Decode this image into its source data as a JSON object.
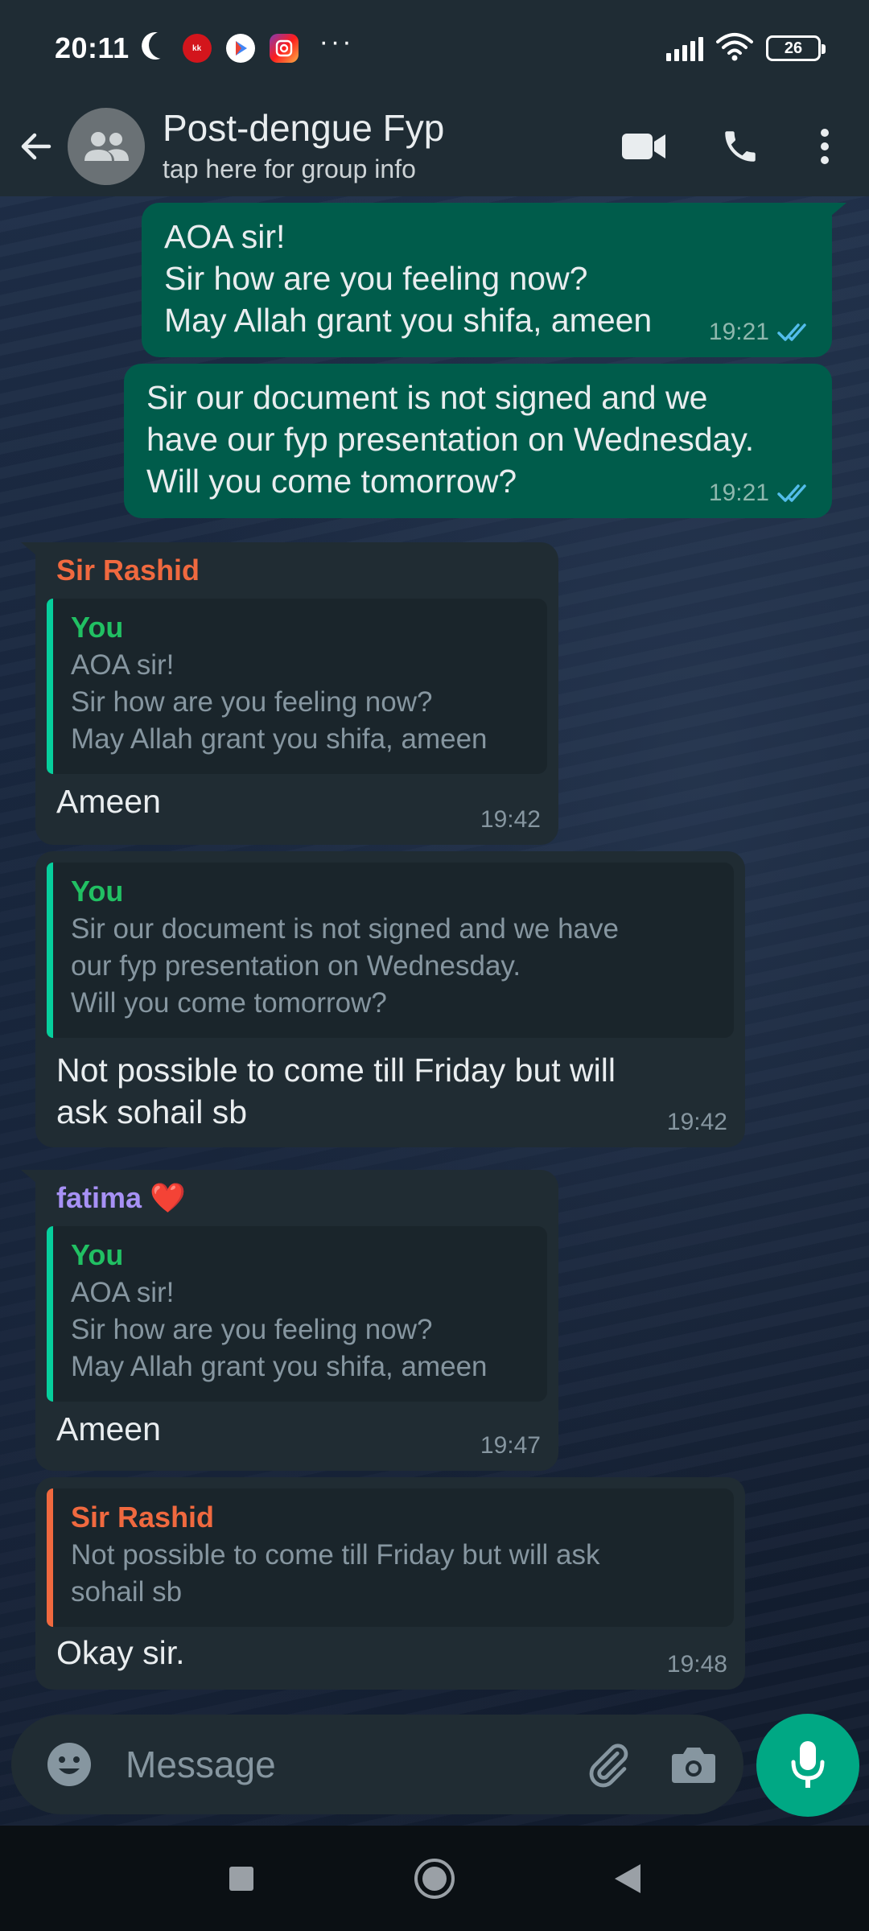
{
  "status_bar": {
    "time": "20:11",
    "battery": "26",
    "app_icon_red": "kk"
  },
  "header": {
    "title": "Post-dengue Fyp",
    "subtitle": "tap here for group info"
  },
  "messages": [
    {
      "direction": "out",
      "text": "AOA sir!\nSir how are you feeling now?\nMay Allah grant you shifa, ameen",
      "time": "19:21",
      "status": "read"
    },
    {
      "direction": "out",
      "text": "Sir our document is not signed and we\nhave our fyp presentation on Wednesday.\nWill you come tomorrow?",
      "time": "19:21",
      "status": "read"
    },
    {
      "direction": "in",
      "sender": "Sir Rashid",
      "sender_color": "#f0693f",
      "quote_author": "You",
      "quote_text": "AOA sir!\nSir how are you feeling now?\nMay Allah grant you shifa, ameen",
      "text": "Ameen",
      "time": "19:42"
    },
    {
      "direction": "in",
      "quote_author": "You",
      "quote_text": "Sir our document is not signed and we have\nour fyp presentation on Wednesday.\nWill you come tomorrow?",
      "text": "Not possible to come till Friday but will\nask sohail sb",
      "time": "19:42"
    },
    {
      "direction": "in",
      "sender": "fatima",
      "sender_emoji": "❤️",
      "sender_color": "#a791f5",
      "quote_author": "You",
      "quote_text": "AOA sir!\nSir how are you feeling now?\nMay Allah grant you shifa, ameen",
      "text": "Ameen",
      "time": "19:47"
    },
    {
      "direction": "in",
      "quote_author": "Sir Rashid",
      "quote_author_color": "#f0693f",
      "quote_text": "Not possible to come till Friday but will ask\nsohail sb",
      "text": "Okay sir.",
      "time": "19:48"
    }
  ],
  "composer": {
    "placeholder": "Message"
  },
  "colors": {
    "accent": "#00a884",
    "outgoing_bubble": "#005c4b",
    "incoming_bubble": "#202c33",
    "read_ticks": "#53bdeb"
  }
}
